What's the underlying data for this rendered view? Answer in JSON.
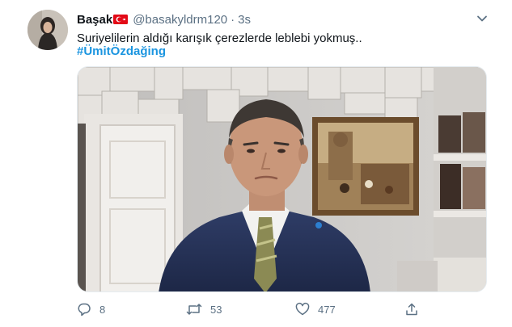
{
  "tweet": {
    "author_name": "Başak",
    "handle": "@basakyldrm120",
    "separator": "·",
    "time": "3s",
    "text": "Suriyelilerin aldığı karışık çerezlerde leblebi yokmuş..",
    "hashtag": "#ÜmitÖzdağing"
  },
  "stats": {
    "replies": "8",
    "retweets": "53",
    "likes": "477"
  },
  "icons": {
    "flag": "turkey-flag-icon",
    "menu": "chevron-down-icon",
    "reply": "reply-icon",
    "retweet": "retweet-icon",
    "like": "heart-icon",
    "share": "share-icon"
  },
  "colors": {
    "hashtag": "#1b95e0",
    "muted": "#5b7083",
    "text": "#0f1419"
  }
}
